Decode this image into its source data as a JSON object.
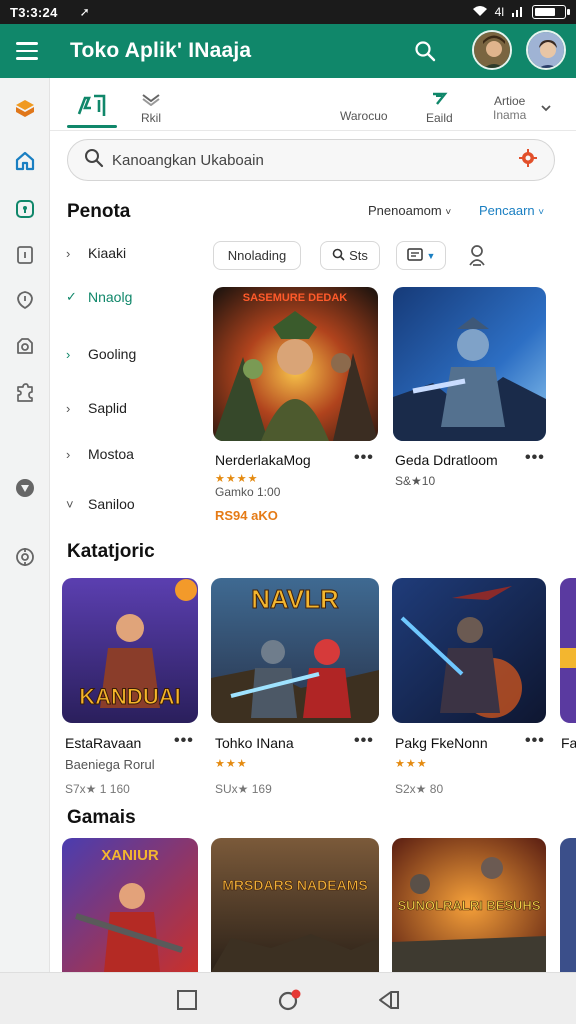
{
  "status_bar": {
    "time": "T3:3:24",
    "signal_text": "4l",
    "battery_level": 0.75
  },
  "app_bar": {
    "title": "Toko Aplik' INaaja",
    "avatar_count": 2
  },
  "top_tabs": [
    {
      "label": "",
      "icon": "store-tag-icon",
      "active": true
    },
    {
      "label": "Rkil",
      "icon": "layers-icon"
    },
    {
      "label": "Warocuo",
      "icon": ""
    },
    {
      "label": "Eaild",
      "icon": "recent-arrow-icon"
    },
    {
      "label": "Artioe",
      "label2": "Inama",
      "icon": ""
    }
  ],
  "search": {
    "placeholder": "Kanoangkan Ukaboain"
  },
  "filter_section": {
    "title": "Penota",
    "sort_label": "Pnenoamom",
    "sort2_label": "Pencaarn",
    "chips": [
      "Nnolading",
      "Sts"
    ]
  },
  "categories": [
    {
      "label": "Kiaaki",
      "chevron": "›"
    },
    {
      "label": "Nnaolg",
      "chevron": "✓",
      "active": true
    },
    {
      "label": "Gooling",
      "chevron": "›"
    },
    {
      "label": "Saplid",
      "chevron": "›"
    },
    {
      "label": "Mostoa",
      "chevron": "›"
    },
    {
      "label": "Saniloo",
      "chevron": "˅"
    }
  ],
  "featured_games": [
    {
      "name": "NerderlakaMog",
      "stars": "★★★★",
      "sub": "Gamko 1:00",
      "price": "RS94 aKO",
      "banner": "SASEMURE DEDAK",
      "more": "•••"
    },
    {
      "name": "Geda Ddratloom",
      "stars": "",
      "sub": "S&★10",
      "price": "",
      "banner": "",
      "more": "•••"
    }
  ],
  "section2": {
    "title": "Katatjoric",
    "games": [
      {
        "name": "EstaRavaan",
        "sub": "Baeniega Rorul",
        "meta": "S7x★ 1 160",
        "banner": "KANDUAI",
        "more": "•••"
      },
      {
        "name": "Tohko INana",
        "stars": "★★★",
        "meta": "SUx★ 169",
        "banner": "NAVLR",
        "more": "•••"
      },
      {
        "name": "Pakg FkeNonn",
        "stars": "★★★",
        "meta": "S2x★ 80",
        "banner": "",
        "more": "•••"
      },
      {
        "name": "Fa"
      }
    ]
  },
  "section3": {
    "title": "Gamais",
    "games": [
      {
        "banner": "XANIUR"
      },
      {
        "banner": "MRSDARS NADEAMS"
      },
      {
        "banner": "SUNOLRALRI BESUHS"
      }
    ]
  },
  "colors": {
    "primary": "#10876a",
    "accent_orange": "#e57b16",
    "star": "#e48a10"
  }
}
